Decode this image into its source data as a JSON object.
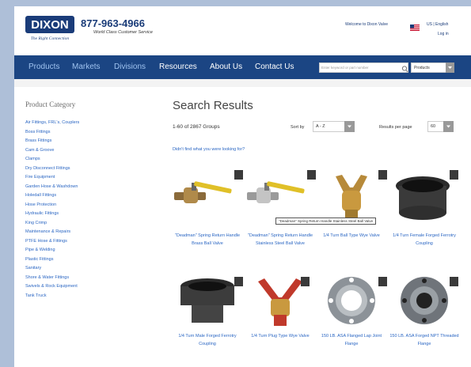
{
  "header": {
    "logo_text": "DIXON",
    "logo_tagline": "The Right Connection",
    "phone": "877-963-4966",
    "tagline": "World Class Customer Service",
    "welcome": "Welcome to Dixon Valve",
    "language": "US | English",
    "login": "Log in"
  },
  "nav": {
    "items": [
      "Products",
      "Markets",
      "Divisions",
      "Resources",
      "About Us",
      "Contact Us"
    ],
    "search_placeholder": "Enter keyword or part number",
    "search_scope": "Products"
  },
  "sidebar": {
    "title": "Product Category",
    "categories": [
      "Air Fittings, FRL's, Couplers",
      "Boss Fittings",
      "Brass Fittings",
      "Cam & Groove",
      "Clamps",
      "Dry Disconnect Fittings",
      "Fire Equipment",
      "Garden Hose & Washdown",
      "Holedall Fittings",
      "Hose Protection",
      "Hydraulic Fittings",
      "King Crimp",
      "Maintenance & Repairs",
      "PTFE Hose & Fittings",
      "Pipe & Welding",
      "Plastic Fittings",
      "Sanitary",
      "Shore & Water Fittings",
      "Swivels & Rock Equipment",
      "Tank Truck"
    ]
  },
  "results": {
    "title": "Search Results",
    "count": "1-60 of 2867 Groups",
    "sort_label": "Sort by",
    "sort_value": "A - Z",
    "per_page_label": "Results per page",
    "per_page_value": "60",
    "didnt_find": "Didn't find what you were looking for?",
    "tooltip": "\"Deadman\" Spring Return Handle Stainless Steel Ball Valve",
    "products": [
      "\"Deadman\" Spring Return Handle Brass Ball Valve",
      "\"Deadman\" Spring Return Handle Stainless Steel Ball Valve",
      "1/4 Turn Ball Type Wye Valve",
      "1/4 Turn Female Forged Ferrotry Coupling",
      "1/4 Turn Male Forged Ferrotry Coupling",
      "1/4 Turn Plug Type Wye Valve",
      "150 LB. ASA Flanged Lap Joint Flange",
      "150 LB. ASA Forged NPT Threaded Flange"
    ]
  },
  "colors": {
    "nav_bg": "#1b4583",
    "link": "#2a66c3",
    "brand": "#1a3c79"
  }
}
